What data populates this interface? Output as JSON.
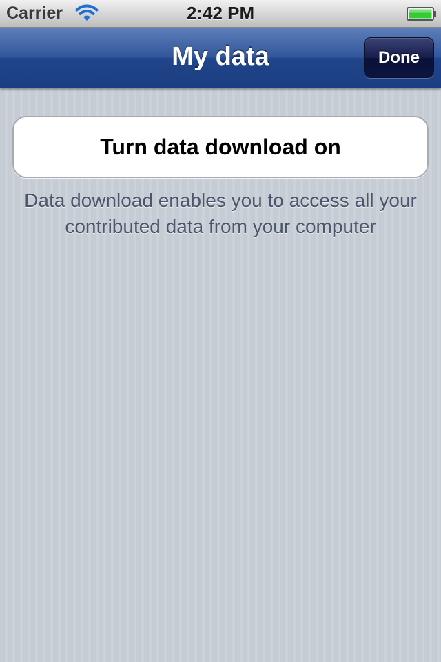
{
  "status_bar": {
    "carrier": "Carrier",
    "time": "2:42 PM",
    "wifi_icon": "wifi-icon",
    "battery_icon": "battery-icon",
    "battery_level": 1.0,
    "battery_color": "#33cc33"
  },
  "nav": {
    "title": "My data",
    "done_label": "Done"
  },
  "content": {
    "toggle_label": "Turn data download on",
    "description": "Data download enables you to access all your contributed data from your computer"
  },
  "colors": {
    "nav_bar": "#2c4e93",
    "done_button": "#141b45",
    "background": "#c5ccd4",
    "description_text": "#4c566c"
  }
}
